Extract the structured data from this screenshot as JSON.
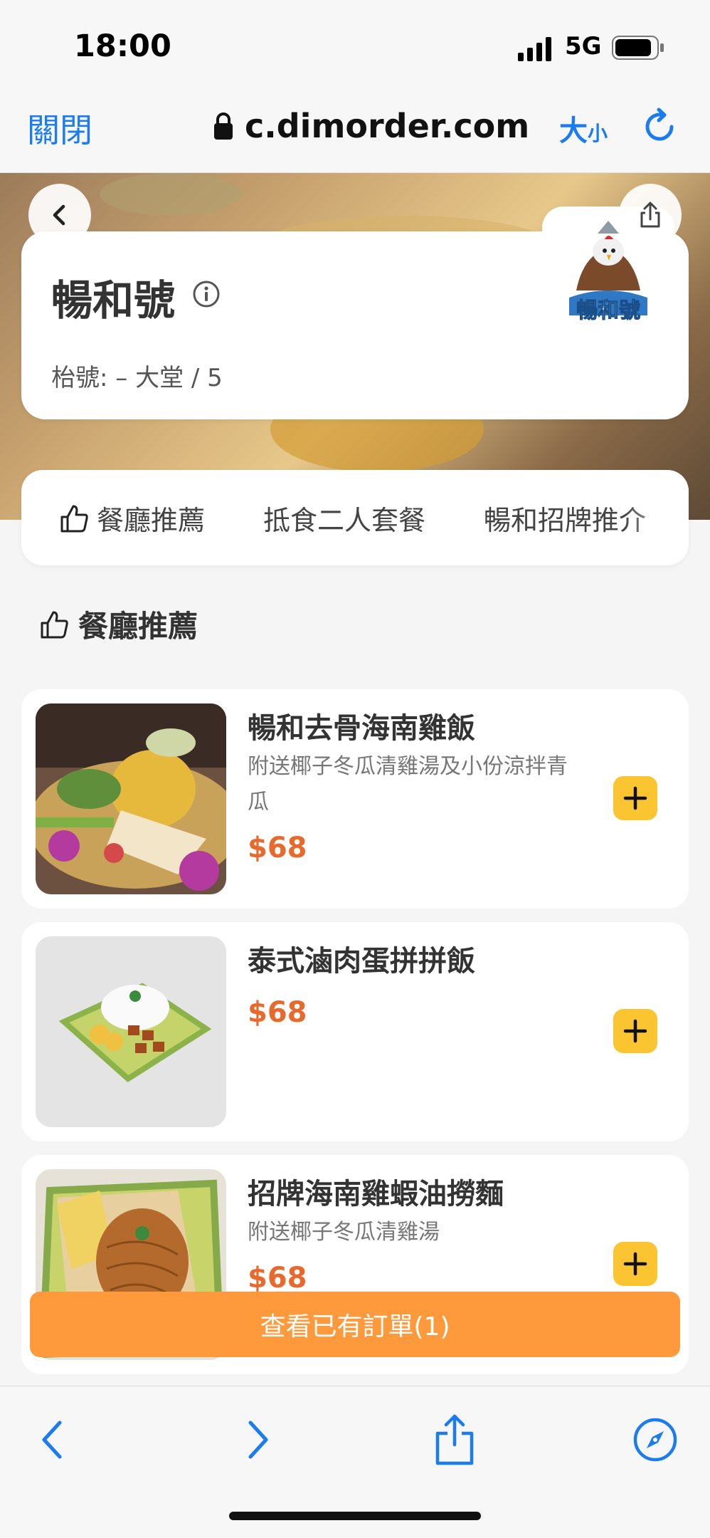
{
  "status_bar": {
    "time": "18:00",
    "network": "5G"
  },
  "browser": {
    "close_label": "關閉",
    "url": "c.dimorder.com",
    "size_label_big": "大",
    "size_label_small": "小"
  },
  "restaurant": {
    "name": "暢和號",
    "table_info": "枱號: – 大堂 / 5",
    "logo_text": "暢和號"
  },
  "categories": [
    {
      "label": "餐廳推薦",
      "icon": "thumbs-up-icon"
    },
    {
      "label": "抵食二人套餐"
    },
    {
      "label": "暢和招牌推介"
    }
  ],
  "section": {
    "title": "餐廳推薦",
    "icon": "thumbs-up-icon"
  },
  "menu_items": [
    {
      "name": "暢和去骨海南雞飯",
      "description": "附送椰子冬瓜清雞湯及小份涼拌青瓜",
      "price": "$68"
    },
    {
      "name": "泰式滷肉蛋拼拼飯",
      "description": "",
      "price": "$68"
    },
    {
      "name": "招牌海南雞蝦油撈麵",
      "description": "附送椰子冬瓜清雞湯",
      "price": "$68"
    }
  ],
  "order_bar": {
    "label": "查看已有訂單(1)"
  },
  "colors": {
    "accent_blue": "#1a7cf0",
    "price_orange": "#e8692b",
    "order_orange": "#ff9a3c",
    "add_yellow": "#fbc531"
  }
}
